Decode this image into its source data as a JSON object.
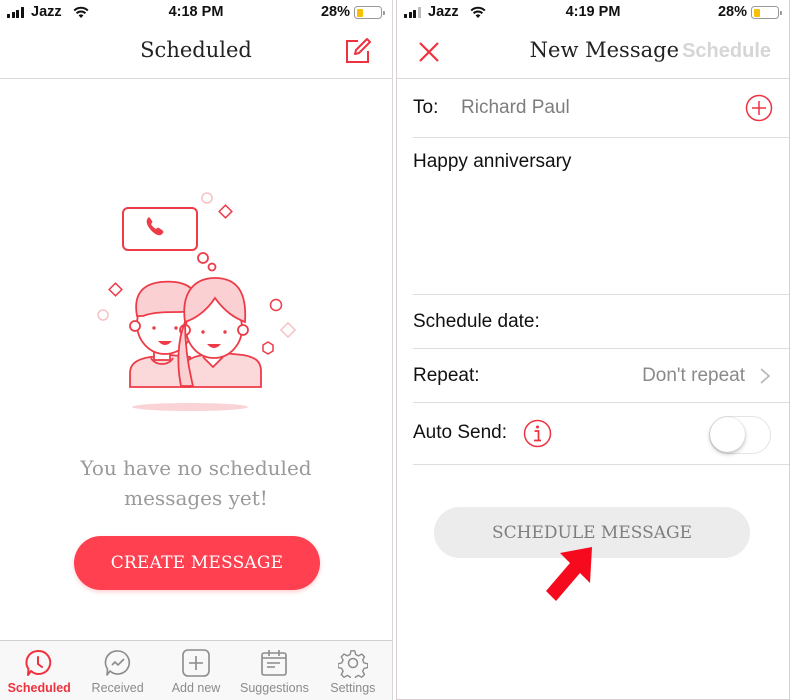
{
  "left_screen": {
    "status_bar": {
      "carrier": "Jazz",
      "time": "4:18 PM",
      "battery_percent": "28%",
      "battery_level": 0.28
    },
    "header": {
      "title": "Scheduled",
      "compose_icon": "compose-icon"
    },
    "empty_state": {
      "illustration": "couple-with-phone-call-bubble",
      "message": "You have no scheduled messages yet!"
    },
    "create_button_label": "CREATE MESSAGE",
    "tab_bar": {
      "items": [
        {
          "label": "Scheduled",
          "icon": "clock-bubble-icon",
          "active": true
        },
        {
          "label": "Received",
          "icon": "checkmark-bubble-icon",
          "active": false
        },
        {
          "label": "Add new",
          "icon": "plus-square-icon",
          "active": false
        },
        {
          "label": "Suggestions",
          "icon": "calendar-icon",
          "active": false
        },
        {
          "label": "Settings",
          "icon": "gear-icon",
          "active": false
        }
      ]
    }
  },
  "right_screen": {
    "status_bar": {
      "carrier": "Jazz",
      "time": "4:19 PM",
      "battery_percent": "28%",
      "battery_level": 0.28
    },
    "header": {
      "title": "New Message",
      "cancel_icon": "close-icon",
      "schedule_link": "Schedule"
    },
    "form": {
      "to_label": "To:",
      "to_value": "Richard Paul",
      "message_body": "Happy anniversary",
      "schedule_date_label": "Schedule date:",
      "schedule_date_value": "",
      "repeat_label": "Repeat:",
      "repeat_value": "Don't repeat",
      "auto_send_label": "Auto Send:",
      "auto_send_enabled": false
    },
    "schedule_button_label": "SCHEDULE MESSAGE",
    "annotation": "red-arrow-pointing-to-schedule-button"
  },
  "colors": {
    "accent": "#f0323f",
    "create_button": "#ff4050",
    "disabled_button": "#ececec",
    "battery_fill": "#f7c100"
  }
}
